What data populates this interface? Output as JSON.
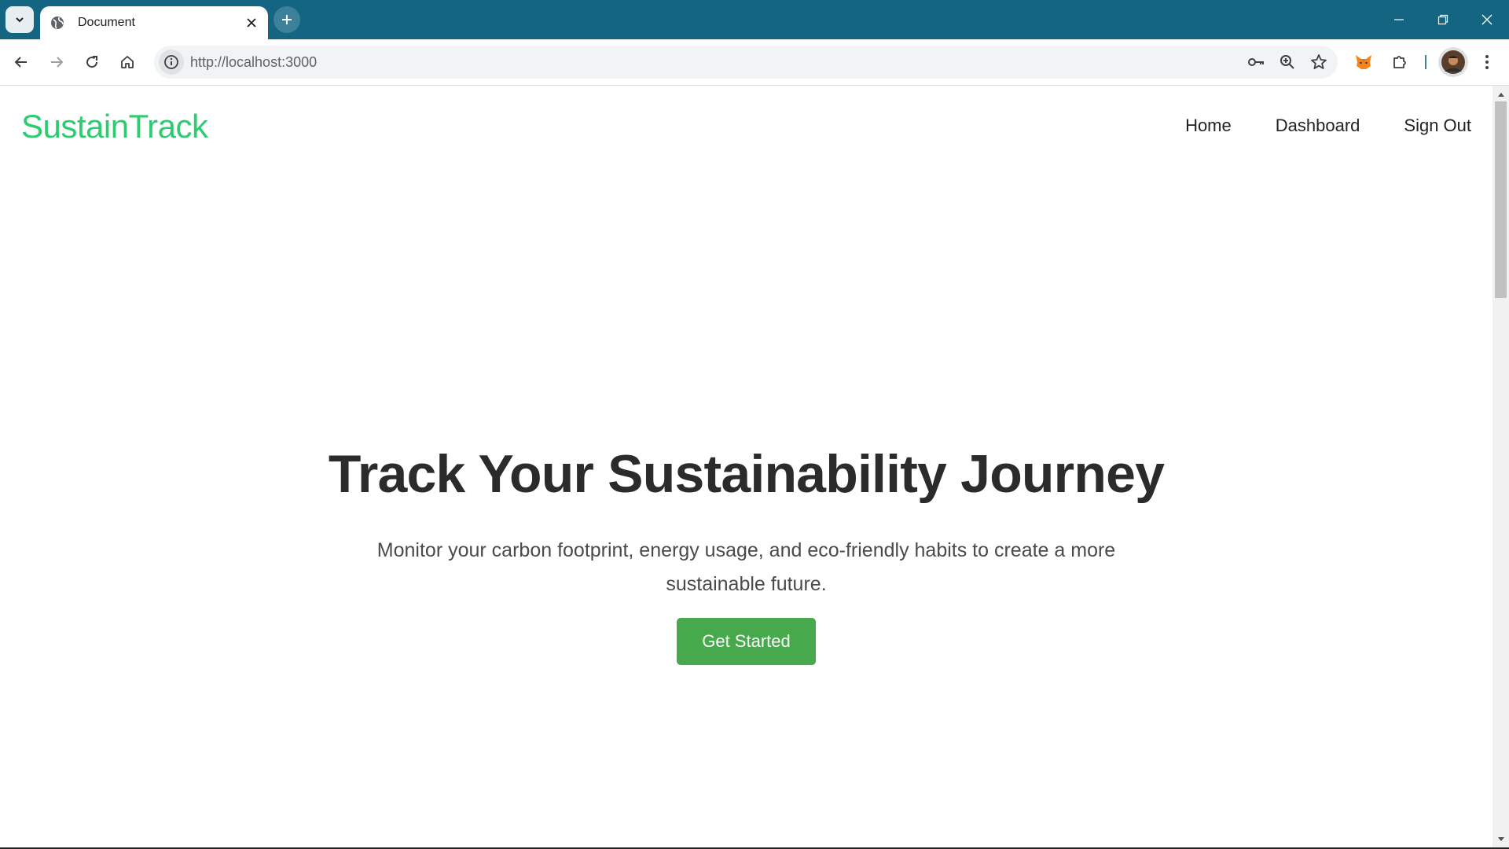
{
  "browser": {
    "tab_title": "Document",
    "url": "http://localhost:3000",
    "chrome_color": "#136582",
    "icons": {
      "tab_search": "chevron-down-icon",
      "favicon": "globe-icon",
      "tab_close": "close-icon",
      "new_tab": "plus-icon",
      "back": "arrow-left-icon",
      "forward": "arrow-right-icon",
      "reload": "reload-icon",
      "home": "home-icon",
      "site_info": "info-icon",
      "password": "key-icon",
      "zoom": "zoom-icon",
      "bookmark": "star-icon",
      "extension_fox": "fox-extension-icon",
      "extensions": "puzzle-icon",
      "profile": "avatar",
      "menu": "kebab-menu-icon",
      "minimize": "minimize-icon",
      "restore": "restore-icon",
      "close_window": "close-window-icon"
    }
  },
  "page": {
    "brand": "SustainTrack",
    "brand_color": "#2ecc71",
    "nav": {
      "home": "Home",
      "dashboard": "Dashboard",
      "sign_out": "Sign Out"
    },
    "hero": {
      "title": "Track Your Sustainability Journey",
      "subtitle": "Monitor your carbon footprint, energy usage, and eco-friendly habits to create a more sustainable future.",
      "cta_label": "Get Started",
      "cta_color": "#46a94c"
    }
  }
}
